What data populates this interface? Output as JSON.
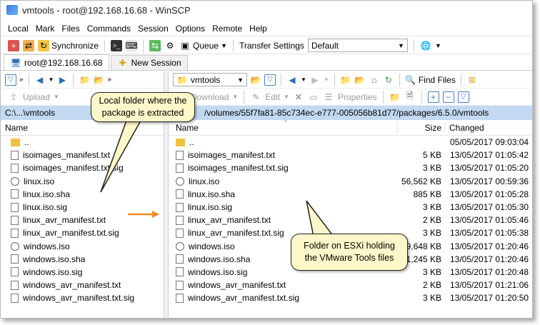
{
  "window": {
    "title": "vmtools - root@192.168.16.68 - WinSCP"
  },
  "menu": [
    "Local",
    "Mark",
    "Files",
    "Commands",
    "Session",
    "Options",
    "Remote",
    "Help"
  ],
  "toolbar": {
    "synchronize": "Synchronize",
    "queue": "Queue",
    "transfer_settings_label": "Transfer Settings",
    "transfer_settings_value": "Default"
  },
  "tabs": {
    "session": "root@192.168.16.68",
    "new_session": "New Session"
  },
  "left": {
    "upload": "Upload",
    "path": "C:\\...\\vmtools",
    "name_header": "Name",
    "files": [
      "..",
      "isoimages_manifest.txt",
      "isoimages_manifest.txt.sig",
      "linux.iso",
      "linux.iso.sha",
      "linux.iso.sig",
      "linux_avr_manifest.txt",
      "linux_avr_manifest.txt.sig",
      "windows.iso",
      "windows.iso.sha",
      "windows.iso.sig",
      "windows_avr_manifest.txt",
      "windows_avr_manifest.txt.sig"
    ]
  },
  "right": {
    "folder_combo": "vmtools",
    "find_files": "Find Files",
    "download": "Download",
    "edit": "Edit",
    "properties": "Properties",
    "path": "/volumes/55f7fa81-85c734ec-e777-005056b81d77/packages/6.5.0/vmtools",
    "headers": {
      "name": "Name",
      "size": "Size",
      "changed": "Changed"
    },
    "files": [
      {
        "name": "..",
        "size": "",
        "changed": "05/05/2017 09:03:04"
      },
      {
        "name": "isoimages_manifest.txt",
        "size": "5 KB",
        "changed": "13/05/2017 01:05:42"
      },
      {
        "name": "isoimages_manifest.txt.sig",
        "size": "3 KB",
        "changed": "13/05/2017 01:05:20"
      },
      {
        "name": "linux.iso",
        "size": "56,562 KB",
        "changed": "13/05/2017 00:59:36"
      },
      {
        "name": "linux.iso.sha",
        "size": "885 KB",
        "changed": "13/05/2017 01:05:28"
      },
      {
        "name": "linux.iso.sig",
        "size": "3 KB",
        "changed": "13/05/2017 01:05:30"
      },
      {
        "name": "linux_avr_manifest.txt",
        "size": "2 KB",
        "changed": "13/05/2017 01:05:46"
      },
      {
        "name": "linux_avr_manifest.txt.sig",
        "size": "3 KB",
        "changed": "13/05/2017 01:05:38"
      },
      {
        "name": "windows.iso",
        "size": "79,648 KB",
        "changed": "13/05/2017 01:20:46"
      },
      {
        "name": "windows.iso.sha",
        "size": "1,245 KB",
        "changed": "13/05/2017 01:20:46"
      },
      {
        "name": "windows.iso.sig",
        "size": "3 KB",
        "changed": "13/05/2017 01:20:48"
      },
      {
        "name": "windows_avr_manifest.txt",
        "size": "2 KB",
        "changed": "13/05/2017 01:21:06"
      },
      {
        "name": "windows_avr_manifest.txt.sig",
        "size": "3 KB",
        "changed": "13/05/2017 01:20:50"
      }
    ]
  },
  "callouts": {
    "local": "Local folder where the package is extracted",
    "esxi": "Folder on ESXi holding the VMware Tools files"
  },
  "colors": {
    "path_bar": "#c3d9f1",
    "callout_bg": "#fff7c9",
    "arrow": "#f08a24"
  }
}
